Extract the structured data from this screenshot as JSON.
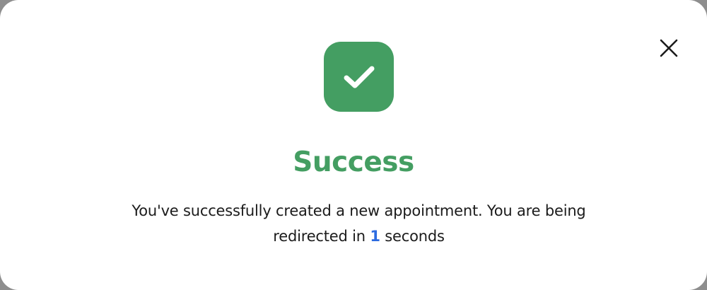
{
  "colors": {
    "success": "#449e62",
    "countdown": "#2c6be0",
    "text": "#1b1b1b",
    "close_icon": "#1b1b1b"
  },
  "dialog": {
    "close_icon": "close-icon",
    "badge_icon": "checkmark-icon",
    "title": "Success",
    "message_part1": "You've successfully created a new appointment. You are being redirected in",
    "countdown": "1",
    "message_part2": "seconds"
  }
}
